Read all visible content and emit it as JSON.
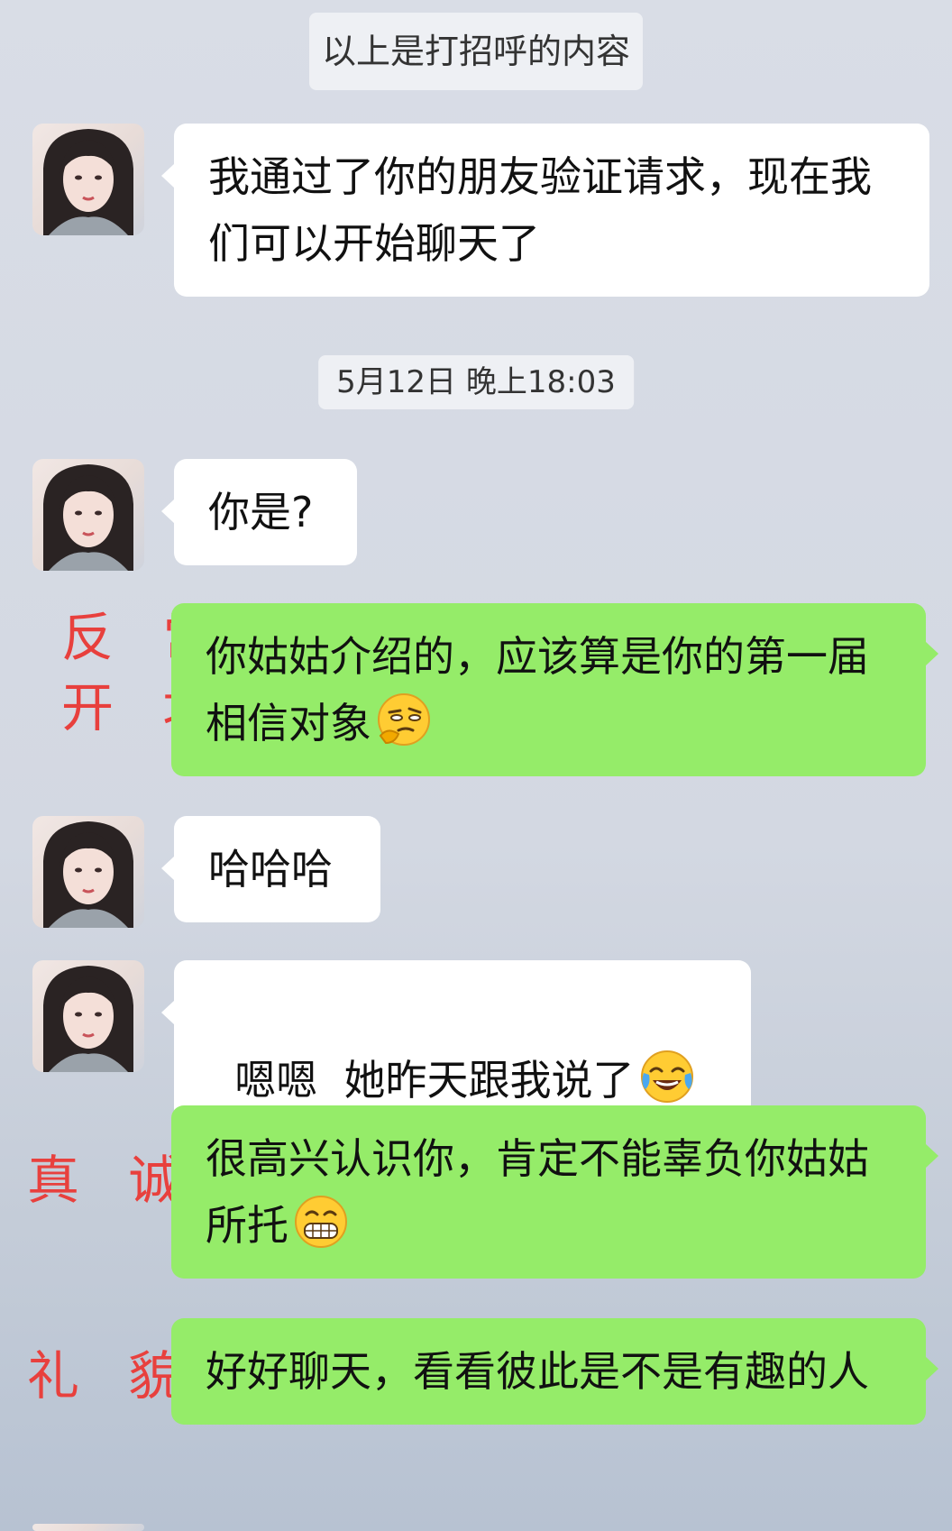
{
  "system": {
    "greeting_notice": "以上是打招呼的内容",
    "timestamp": "5月12日 晚上18:03"
  },
  "messages": [
    {
      "side": "in",
      "text": "我通过了你的朋友验证请求，现在我们可以开始聊天了"
    },
    {
      "side": "in",
      "text": "你是?"
    },
    {
      "side": "out",
      "text": "你姑姑介绍的，应该算是你的第一届相信对象",
      "emoji": "smirk-hand-on-chin-emoji"
    },
    {
      "side": "in",
      "text": "哈哈哈"
    },
    {
      "side": "in",
      "text": "嗯嗯  她昨天跟我说了",
      "emoji": "tears-of-joy-emoji"
    },
    {
      "side": "out",
      "text": "很高兴认识你，肯定不能辜负你姑姑所托",
      "emoji": "grinning-teeth-emoji"
    },
    {
      "side": "out",
      "text": "好好聊天，看看彼此是不是有趣的人"
    }
  ],
  "annotations": {
    "opening": "反 常\n开 场",
    "sincere": "真 诚",
    "polite": "礼 貌"
  },
  "colors": {
    "outgoing_bubble": "#95ec69",
    "incoming_bubble": "#ffffff",
    "annotation_text": "#e8403d"
  }
}
